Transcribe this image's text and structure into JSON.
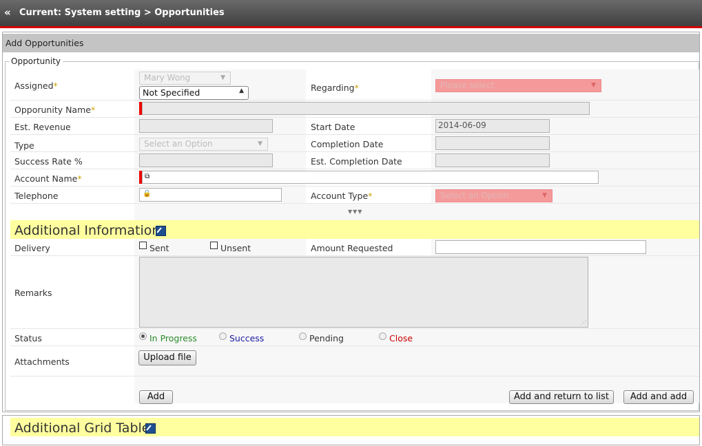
{
  "header": {
    "back_icon": "«",
    "breadcrumb": "Current: System setting > Opportunities"
  },
  "panel": {
    "title": "Add Opportunities"
  },
  "opportunity": {
    "legend": "Opportunity",
    "labels": {
      "assigned": "Assigned",
      "regarding": "Regarding",
      "opportunity_name": "Opporunity Name",
      "est_revenue": "Est. Revenue",
      "start_date": "Start Date",
      "type": "Type",
      "completion_date": "Completion Date",
      "success_rate": "Success Rate %",
      "est_completion_date": "Est. Completion Date",
      "account_name": "Account Name",
      "telephone": "Telephone",
      "account_type": "Account Type"
    },
    "required_marker": "*",
    "assigned_value": "Mary Wong",
    "assigned_sub_value": "Not Specified",
    "regarding_placeholder": "Please select",
    "start_date_value": "2014-06-09",
    "type_placeholder": "Select an Option",
    "account_type_placeholder": "Select an Option",
    "expand_toggle": "▼▼▼"
  },
  "additional_info": {
    "title": "Additional Information",
    "labels": {
      "delivery": "Delivery",
      "amount_requested": "Amount Requested",
      "remarks": "Remarks",
      "status": "Status",
      "attachments": "Attachments"
    },
    "delivery_options": [
      "Sent",
      "Unsent"
    ],
    "status_options": [
      {
        "label": "In Progress",
        "color": "#2a8a2a",
        "selected": true
      },
      {
        "label": "Success",
        "color": "#1a1aa0",
        "selected": false
      },
      {
        "label": "Pending",
        "color": "#333333",
        "selected": false
      },
      {
        "label": "Close",
        "color": "#cc0000",
        "selected": false
      }
    ],
    "upload_button": "Upload file"
  },
  "actions": {
    "add": "Add",
    "add_return": "Add  and return to list",
    "add_and_add": "Add  and add"
  },
  "grid_section": {
    "title": "Additional Grid Table"
  },
  "colors": {
    "accent_red": "#d40000",
    "section_yellow": "#ffff9f",
    "required_pink": "#f59a9a"
  }
}
